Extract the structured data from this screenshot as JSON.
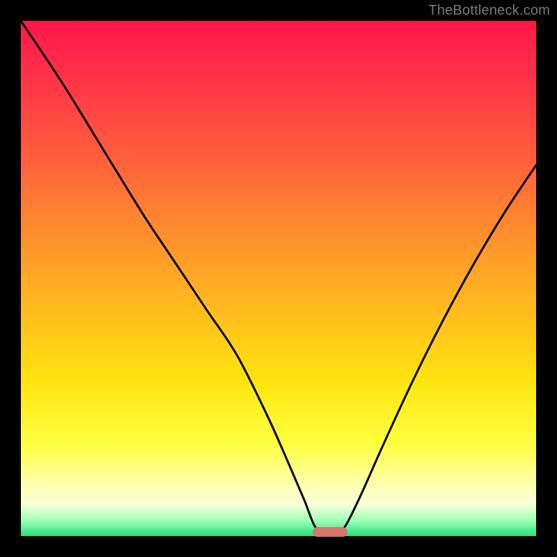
{
  "watermark": "TheBottleneck.com",
  "colors": {
    "frame": "#000000",
    "curve": "#000000",
    "marker": "#d9756b",
    "gradient_top": "#ff1648",
    "gradient_bottom": "#23e27a"
  },
  "chart_data": {
    "type": "line",
    "title": "",
    "xlabel": "",
    "ylabel": "",
    "xlim": [
      0,
      100
    ],
    "ylim": [
      0,
      100
    ],
    "grid": false,
    "legend": false,
    "series": [
      {
        "name": "bottleneck-curve",
        "x": [
          0,
          8,
          16,
          24,
          30,
          36,
          42,
          48,
          52,
          55,
          57,
          59,
          61,
          63,
          66,
          70,
          76,
          82,
          88,
          94,
          100
        ],
        "values": [
          100,
          88,
          75,
          62,
          53,
          44,
          35,
          23,
          14,
          7,
          2,
          0,
          0,
          2,
          8,
          17,
          30,
          42,
          53,
          63,
          72
        ]
      }
    ],
    "marker": {
      "x": 60,
      "y": 0,
      "shape": "rounded-bar"
    },
    "notes": "V-shaped curve on a vertical heat gradient. No visible axis ticks or numeric labels; values are read proportionally (0–100) against the plot area dimensions."
  }
}
